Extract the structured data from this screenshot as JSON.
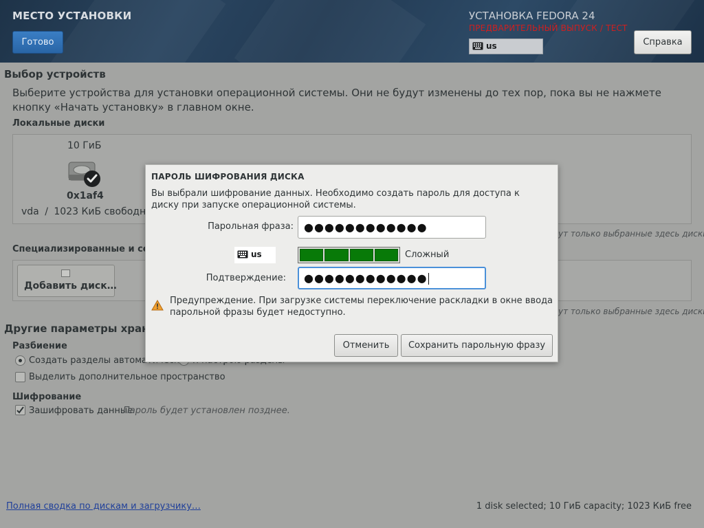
{
  "header": {
    "title": "МЕСТО УСТАНОВКИ",
    "done_label": "Готово",
    "product": "УСТАНОВКА FEDORA 24",
    "prerelease": "ПРЕДВАРИТЕЛЬНЫЙ ВЫПУСК / ТЕСТ",
    "keyboard_layout": "us",
    "help_label": "Справка",
    "prerelease_color": "#cf1f1f"
  },
  "device_selection": {
    "title": "Выбор устройств",
    "description": "Выберите устройства для установки операционной системы. Они не будут изменены до тех пор, пока вы не нажмете кнопку «Начать установку» в главном окне.",
    "local_disks_title": "Локальные диски",
    "disk": {
      "size": "10 ГиБ",
      "name": "0x1af4",
      "device": "vda",
      "separator": "/",
      "free": "1023 КиБ свободно"
    },
    "local_note": "ут только выбранные здесь диски.",
    "specialized_title": "Специализированные и сетев",
    "add_disk_label": "Добавить диск…",
    "specialized_note": "ут только выбранные здесь диски."
  },
  "other_options": {
    "title": "Другие параметры хранения",
    "partitioning_title": "Разбиение",
    "auto_partition_label": "Создать разделы автоматически",
    "manual_partition_label": "Я настрою разделы",
    "extra_space_label": "Выделить дополнительное пространство",
    "encryption_title": "Шифрование",
    "encrypt_label": "Зашифровать данные",
    "encrypt_hint": "Пароль будет установлен позднее."
  },
  "footer": {
    "summary_link": "Полная сводка по дискам и загрузчику…",
    "status": "1 disk selected; 10 ГиБ capacity; 1023 КиБ free"
  },
  "dialog": {
    "title": "ПАРОЛЬ ШИФРОВАНИЯ ДИСКА",
    "description": "Вы выбрали шифрование данных. Необходимо создать пароль для доступа к диску при запуске операционной системы.",
    "passphrase_label": "Парольная фраза:",
    "passphrase_value": "●●●●●●●●●●●●",
    "keyboard_layout": "us",
    "strength_label": "Сложный",
    "strength_segments_filled": 4,
    "strength_color": "#087a08",
    "confirm_label": "Подтверждение:",
    "confirm_value": "●●●●●●●●●●●●",
    "warning": "Предупреждение. При загрузке системы переключение раскладки в окне ввода парольной фразы будет недоступно.",
    "cancel_label": "Отменить",
    "save_label": "Сохранить парольную фразу"
  }
}
